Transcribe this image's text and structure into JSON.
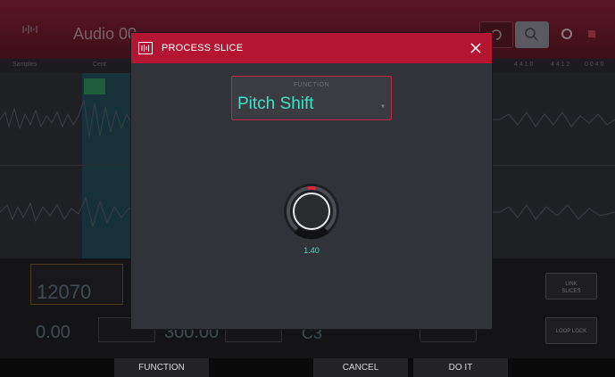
{
  "app": {
    "track_title": "Audio 00"
  },
  "ruler_labels": [
    "Samples",
    "Cent",
    "4 4 1 0",
    "4 4 1 2",
    "0 0 4 0"
  ],
  "panel": {
    "param1_value": "12070",
    "param2_value": "0.00",
    "param3_value": "300.00",
    "param4_value": "C3",
    "link_slices_label": "LINK\nSLICES",
    "loop_lock_label": "LOOP LOCK"
  },
  "dialog": {
    "title": "PROCESS SLICE",
    "function_caption": "FUNCTION",
    "function_value": "Pitch Shift",
    "knob_value": "1.40",
    "knob_level": 0.5
  },
  "softkeys": {
    "function": "FUNCTION",
    "cancel": "CANCEL",
    "do_it": "DO IT"
  },
  "colors": {
    "accent_red": "#b31533",
    "accent_teal": "#3fe0c8",
    "modal_bg": "#313338"
  },
  "icons": {
    "modal_logo": "waveform-logo-icon",
    "close": "close-icon",
    "caret": "dropdown-caret-icon"
  }
}
